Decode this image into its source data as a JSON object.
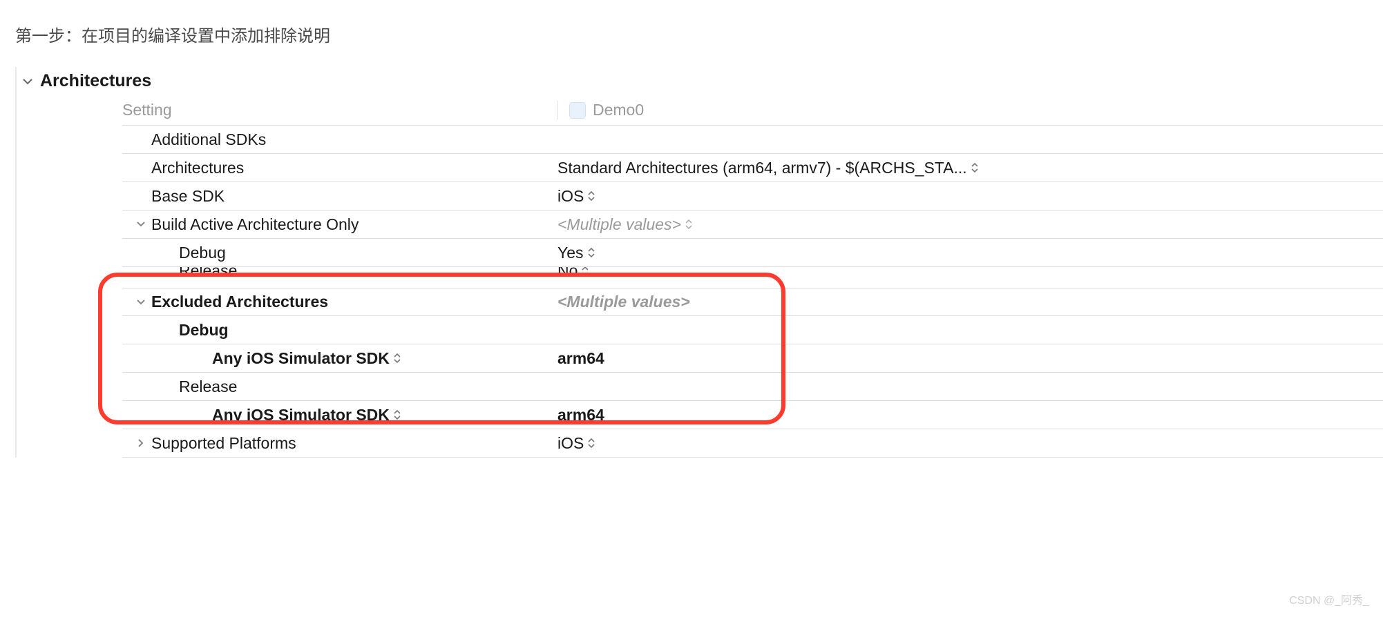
{
  "instruction": "第一步：在项目的编译设置中添加排除说明",
  "section_title": "Architectures",
  "columns": {
    "setting": "Setting",
    "project": "Demo0"
  },
  "rows": {
    "additional_sdks": {
      "label": "Additional SDKs",
      "value": ""
    },
    "architectures": {
      "label": "Architectures",
      "value": "Standard Architectures (arm64, armv7)  -  $(ARCHS_STA..."
    },
    "base_sdk": {
      "label": "Base SDK",
      "value": "iOS"
    },
    "build_active": {
      "label": "Build Active Architecture Only",
      "value": "<Multiple values>"
    },
    "build_active_debug": {
      "label": "Debug",
      "value": "Yes"
    },
    "build_active_release": {
      "label": "Release",
      "value": "No"
    },
    "excluded": {
      "label": "Excluded Architectures",
      "value": "<Multiple values>"
    },
    "excluded_debug": {
      "label": "Debug",
      "value": ""
    },
    "excluded_debug_sim": {
      "label": "Any iOS Simulator SDK",
      "value": "arm64"
    },
    "excluded_release": {
      "label": "Release",
      "value": ""
    },
    "excluded_release_sim": {
      "label": "Any iOS Simulator SDK",
      "value": "arm64"
    },
    "supported_platforms": {
      "label": "Supported Platforms",
      "value": "iOS"
    }
  },
  "watermark": "CSDN @_阿秀_"
}
